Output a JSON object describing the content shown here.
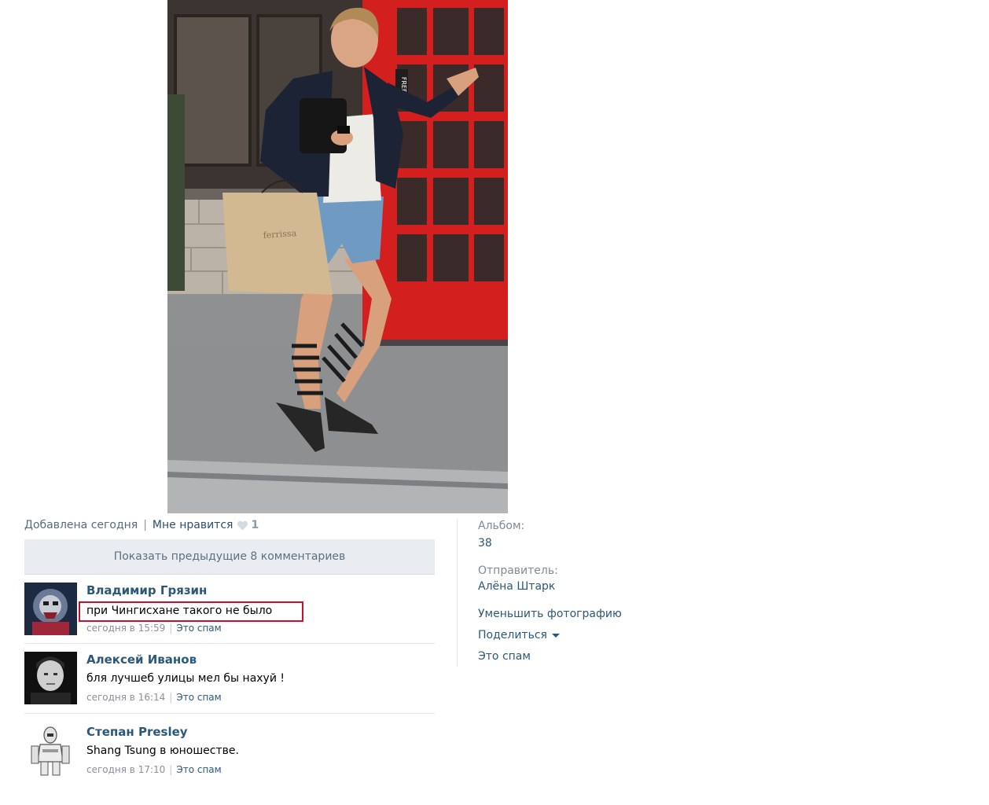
{
  "photo": {
    "bag_brand": "ferrissa",
    "booth_sign": "FREE"
  },
  "meta": {
    "added": "Добавлена сегодня",
    "separator": "|",
    "like_label": "Мне нравится",
    "like_count": "1"
  },
  "show_previous": "Показать предыдущие 8 комментариев",
  "comments": [
    {
      "author": "Владимир Грязин",
      "text": "при Чингисхане такого не было",
      "time": "сегодня в 15:59",
      "spam": "Это спам"
    },
    {
      "author": "Алексей Иванов",
      "text": "бля лучшеб улицы мел бы нахуй !",
      "time": "сегодня в 16:14",
      "spam": "Это спам"
    },
    {
      "author": "Степан Presley",
      "text": "Shang Tsung в юношестве.",
      "time": "сегодня в 17:10",
      "spam": "Это спам"
    }
  ],
  "foot_separator": "|",
  "sidebar": {
    "album_label": "Альбом:",
    "album_value": "38",
    "sender_label": "Отправитель:",
    "sender_value": "Алёна Штарк",
    "reduce_photo": "Уменьшить фотографию",
    "share": "Поделиться",
    "spam": "Это спам"
  },
  "colors": {
    "link": "#2b587a",
    "highlight_box": "#c8102e",
    "booth_red": "#d41f1f"
  },
  "icons": [
    "heart-icon",
    "chevron-down-icon"
  ]
}
